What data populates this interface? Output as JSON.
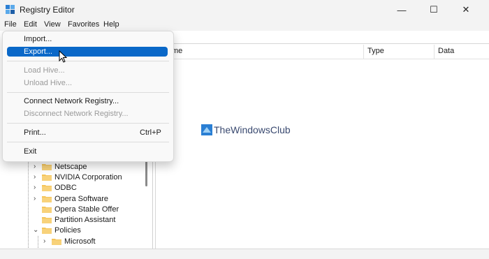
{
  "window": {
    "title": "Registry Editor",
    "controls": {
      "minimize": "—",
      "maximize": "☐",
      "close": "✕"
    }
  },
  "menubar": {
    "items": [
      "File",
      "Edit",
      "View",
      "Favorites",
      "Help"
    ]
  },
  "file_menu": {
    "import": "Import...",
    "export": "Export...",
    "load_hive": "Load Hive...",
    "unload_hive": "Unload Hive...",
    "connect": "Connect Network Registry...",
    "disconnect": "Disconnect Network Registry...",
    "print": "Print...",
    "print_shortcut": "Ctrl+P",
    "exit": "Exit"
  },
  "columns": {
    "name": "me",
    "type": "Type",
    "data": "Data"
  },
  "tree": {
    "items": [
      {
        "label": "Netscape"
      },
      {
        "label": "NVIDIA Corporation"
      },
      {
        "label": "ODBC"
      },
      {
        "label": "Opera Software"
      },
      {
        "label": "Opera Stable Offer"
      },
      {
        "label": "Partition Assistant"
      },
      {
        "label": "Policies"
      },
      {
        "label": "Microsoft"
      }
    ]
  },
  "watermark": {
    "text": "TheWindowsClub"
  },
  "colors": {
    "highlight": "#0a68c8",
    "folder": "#f5c55a",
    "accent_icon": "#2a7fd4"
  }
}
